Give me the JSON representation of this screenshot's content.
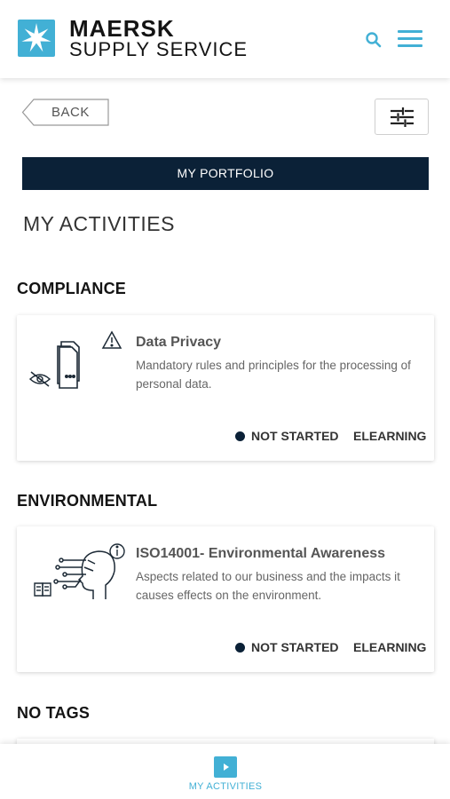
{
  "header": {
    "brand_line1": "MAERSK",
    "brand_line2": "SUPPLY SERVICE",
    "logo_icon": "star-icon",
    "search_icon": "search-icon",
    "menu_icon": "hamburger-menu-icon",
    "accent_color": "#42b0d5"
  },
  "toolbar": {
    "back_label": "BACK",
    "filter_icon": "sliders-icon"
  },
  "portfolio_label": "MY PORTFOLIO",
  "page_title": "MY ACTIVITIES",
  "sections": [
    {
      "title": "COMPLIANCE",
      "cards": [
        {
          "title": "Data Privacy",
          "description": "Mandatory rules and principles for the processing of personal data.",
          "status": "NOT STARTED",
          "type": "ELEARNING",
          "icons": [
            "documents-icon",
            "warning-icon",
            "eye-hidden-icon"
          ]
        }
      ]
    },
    {
      "title": "ENVIRONMENTAL",
      "cards": [
        {
          "title": "ISO14001- Environmental Awareness",
          "description": "Aspects related to our business and the impacts it causes effects on the environment.",
          "status": "NOT STARTED",
          "type": "ELEARNING",
          "icons": [
            "circuit-head-icon",
            "info-icon",
            "book-icon"
          ]
        }
      ]
    },
    {
      "title": "NO TAGS",
      "cards": []
    }
  ],
  "bottom_nav": {
    "label": "MY ACTIVITIES",
    "icon": "play-icon"
  },
  "colors": {
    "navy": "#0b2137",
    "accent": "#42b0d5"
  }
}
